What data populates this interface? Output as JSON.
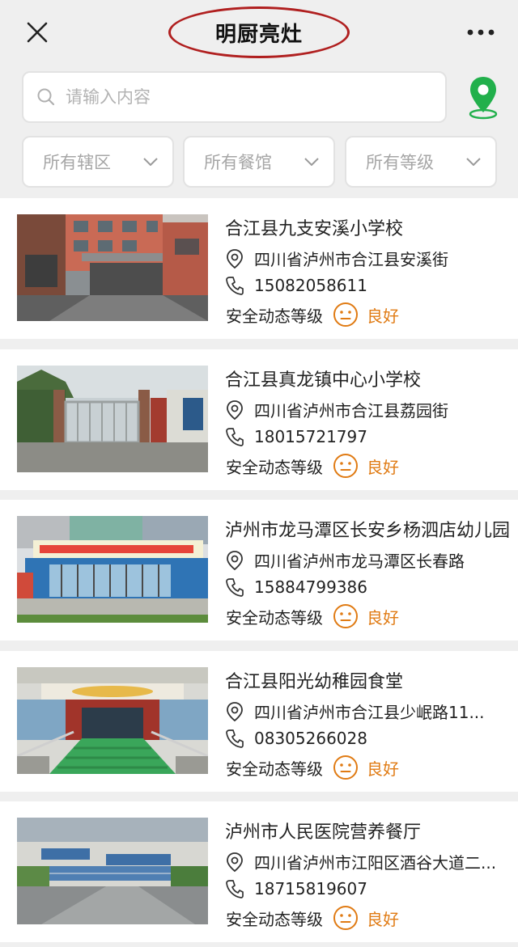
{
  "header": {
    "title": "明厨亮灶",
    "close_icon": "close-icon",
    "more_icon": "more-icon"
  },
  "search": {
    "placeholder": "请输入内容",
    "value": "",
    "location_icon": "map-pin-icon"
  },
  "filters": [
    {
      "label": "所有辖区"
    },
    {
      "label": "所有餐馆"
    },
    {
      "label": "所有等级"
    }
  ],
  "colors": {
    "accent_orange": "#e07b14",
    "location_green": "#22b04c",
    "highlight_red": "#b01f1f"
  },
  "restaurants": [
    {
      "name": "合江县九支安溪小学校",
      "address": "四川省泸州市合江县安溪街",
      "phone": "15082058611",
      "level_label": "安全动态等级",
      "level": "良好"
    },
    {
      "name": "合江县真龙镇中心小学校",
      "address": "四川省泸州市合江县荔园街",
      "phone": "18015721797",
      "level_label": "安全动态等级",
      "level": "良好"
    },
    {
      "name": "泸州市龙马潭区长安乡杨泗店幼儿园",
      "address": "四川省泸州市龙马潭区长春路",
      "phone": "15884799386",
      "level_label": "安全动态等级",
      "level": "良好"
    },
    {
      "name": "合江县阳光幼稚园食堂",
      "address": "四川省泸州市合江县少岷路11...",
      "phone": "08305266028",
      "level_label": "安全动态等级",
      "level": "良好"
    },
    {
      "name": "泸州市人民医院营养餐厅",
      "address": "四川省泸州市江阳区酒谷大道二...",
      "phone": "18715819607",
      "level_label": "安全动态等级",
      "level": "良好"
    }
  ]
}
